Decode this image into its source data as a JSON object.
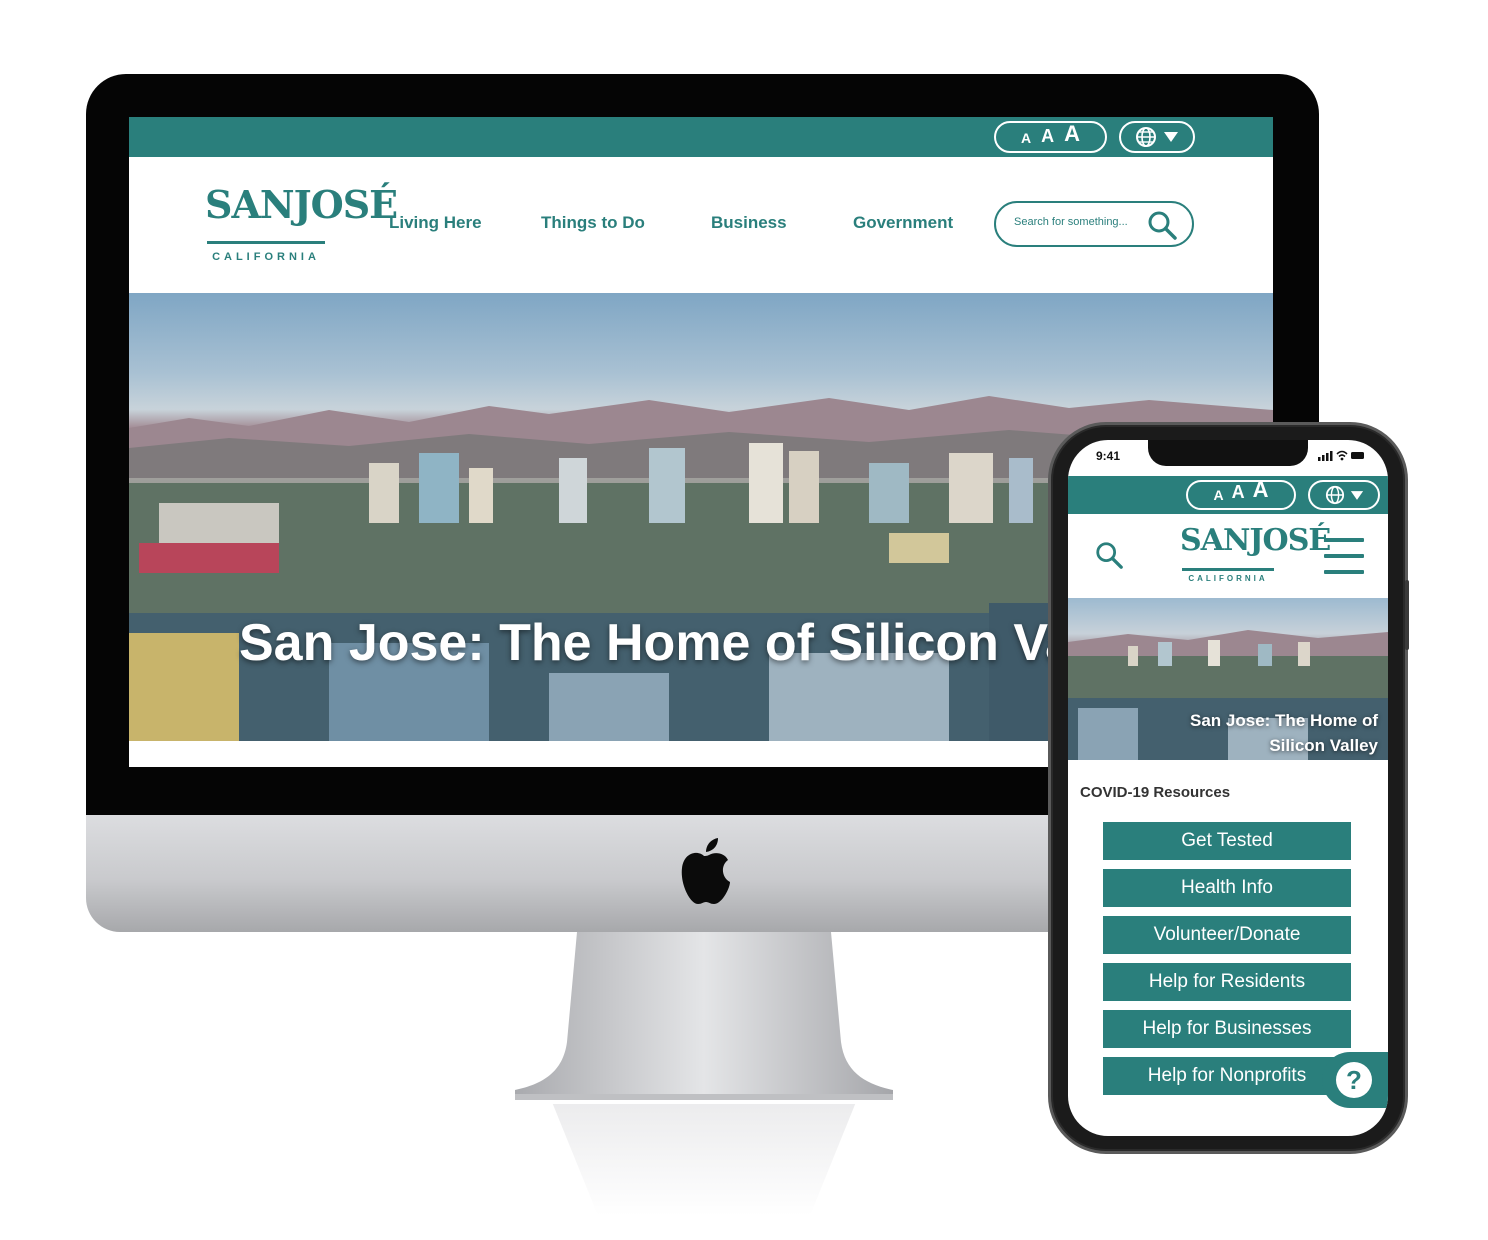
{
  "colors": {
    "brand_teal": "#2a7f7c",
    "white": "#ffffff"
  },
  "desktop": {
    "font_size_controls": [
      "A",
      "A",
      "A"
    ],
    "language_icon": "globe-icon",
    "logo": {
      "main": "SANJOSÉ",
      "sub": "CALIFORNIA"
    },
    "nav": [
      "Living Here",
      "Things to Do",
      "Business",
      "Government"
    ],
    "search": {
      "placeholder": "Search for something..."
    },
    "hero_title": "San Jose: The Home of Silicon Va"
  },
  "mobile": {
    "status_time": "9:41",
    "font_size_controls": [
      "A",
      "A",
      "A"
    ],
    "logo": {
      "main": "SANJOSÉ",
      "sub": "CALIFORNIA"
    },
    "hero_title": "San Jose: The Home of Silicon Valley",
    "section_title": "COVID-19 Resources",
    "buttons": [
      "Get Tested",
      "Health Info",
      "Volunteer/Donate",
      "Help for Residents",
      "Help for Businesses",
      "Help for Nonprofits"
    ],
    "help_button": "?"
  }
}
